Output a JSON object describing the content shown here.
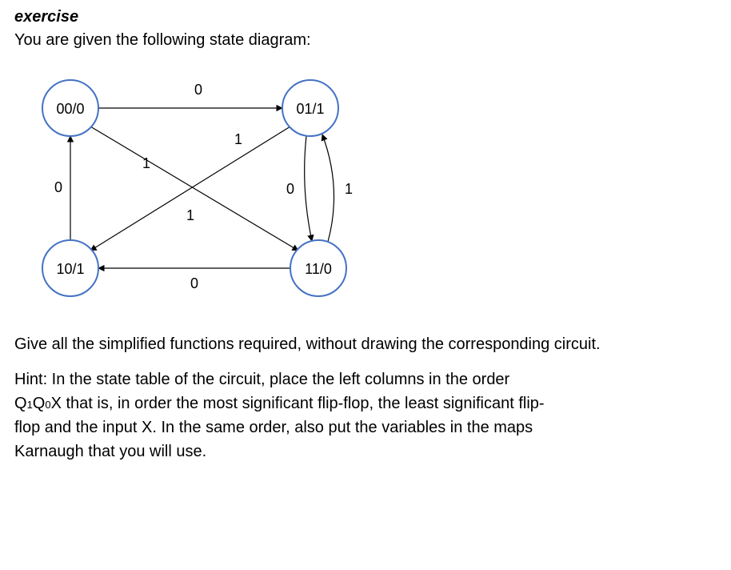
{
  "heading": "exercise",
  "intro": "You are given the following state diagram:",
  "task": "Give all the simplified functions required, without drawing the corresponding circuit.",
  "hint_line1": "Hint: In the state table of the circuit, place the left columns in the order",
  "hint_vars_prefix": "Q",
  "hint_sub1": "1",
  "hint_vars_mid": "Q",
  "hint_sub0": "0",
  "hint_vars_suffix": "X that is, in order the most significant flip-flop, the least significant flip-",
  "hint_line3": "flop and the input X. In the same order, also put the variables in the maps",
  "hint_line4": "Karnaugh that you will use.",
  "diagram": {
    "nodes": {
      "s00": {
        "label": "00/0"
      },
      "s01": {
        "label": "01/1"
      },
      "s10": {
        "label": "10/1"
      },
      "s11": {
        "label": "11/0"
      }
    },
    "edge_labels": {
      "s00_s01": "0",
      "s00_s11": "1",
      "s01_s10": "1",
      "s01_s11": "0",
      "s10_s00": "0",
      "s11_s10": "0",
      "s11_s01": "1"
    }
  },
  "chart_data": {
    "type": "state_diagram",
    "state_encoding": "Q1Q0",
    "output_notation": "state/output (Moore)",
    "states": [
      {
        "id": "00",
        "output": 0
      },
      {
        "id": "01",
        "output": 1
      },
      {
        "id": "10",
        "output": 1
      },
      {
        "id": "11",
        "output": 0
      }
    ],
    "transitions": [
      {
        "from": "00",
        "to": "01",
        "input": 0
      },
      {
        "from": "00",
        "to": "11",
        "input": 1
      },
      {
        "from": "01",
        "to": "10",
        "input": 1
      },
      {
        "from": "01",
        "to": "11",
        "input": 0
      },
      {
        "from": "10",
        "to": "00",
        "input": 0
      },
      {
        "from": "11",
        "to": "10",
        "input": 0
      },
      {
        "from": "11",
        "to": "01",
        "input": 1
      }
    ]
  }
}
